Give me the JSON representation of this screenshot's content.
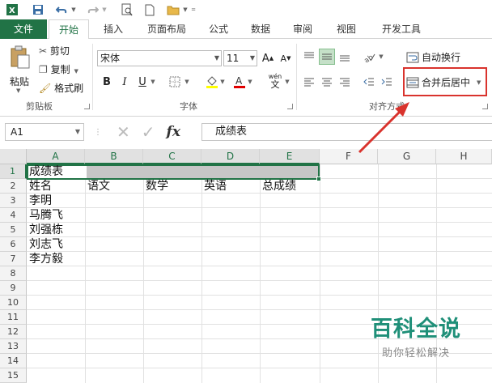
{
  "qat": {
    "icons": [
      "excel-logo-icon",
      "save-icon",
      "undo-icon",
      "redo-icon",
      "print-preview-icon",
      "new-file-icon",
      "open-folder-icon"
    ]
  },
  "tabs": {
    "file": "文件",
    "home": "开始",
    "insert": "插入",
    "page_layout": "页面布局",
    "formulas": "公式",
    "data": "数据",
    "review": "审阅",
    "view": "视图",
    "developer": "开发工具"
  },
  "clipboard": {
    "paste": "粘贴",
    "cut": "剪切",
    "copy": "复制",
    "format_painter": "格式刷",
    "group": "剪贴板"
  },
  "font": {
    "name": "宋体",
    "size": "11",
    "group": "字体",
    "bold": "B",
    "italic": "I",
    "underline": "U",
    "grow": "A",
    "shrink": "A",
    "wen": "wén",
    "wen_char": "文"
  },
  "alignment": {
    "wrap_text": "自动换行",
    "merge_center": "合并后居中",
    "group": "对齐方式"
  },
  "formula_bar": {
    "name_box": "A1",
    "fx": "fx",
    "value": "成绩表"
  },
  "columns": [
    "A",
    "B",
    "C",
    "D",
    "E",
    "F",
    "G",
    "H"
  ],
  "rows": [
    "1",
    "2",
    "3",
    "4",
    "5",
    "6",
    "7",
    "8",
    "9",
    "10",
    "11",
    "12",
    "13",
    "14",
    "15"
  ],
  "cells": {
    "a1": "成绩表",
    "header": [
      "姓名",
      "语文",
      "数学",
      "英语",
      "总成绩"
    ],
    "names": [
      "李明",
      "马腾飞",
      "刘强栋",
      "刘志飞",
      "李方毅"
    ]
  },
  "watermark": {
    "title": "百科全说",
    "subtitle": "助你轻松解决"
  },
  "colors": {
    "excel_green": "#217346",
    "annotation_red": "#d9332d"
  }
}
